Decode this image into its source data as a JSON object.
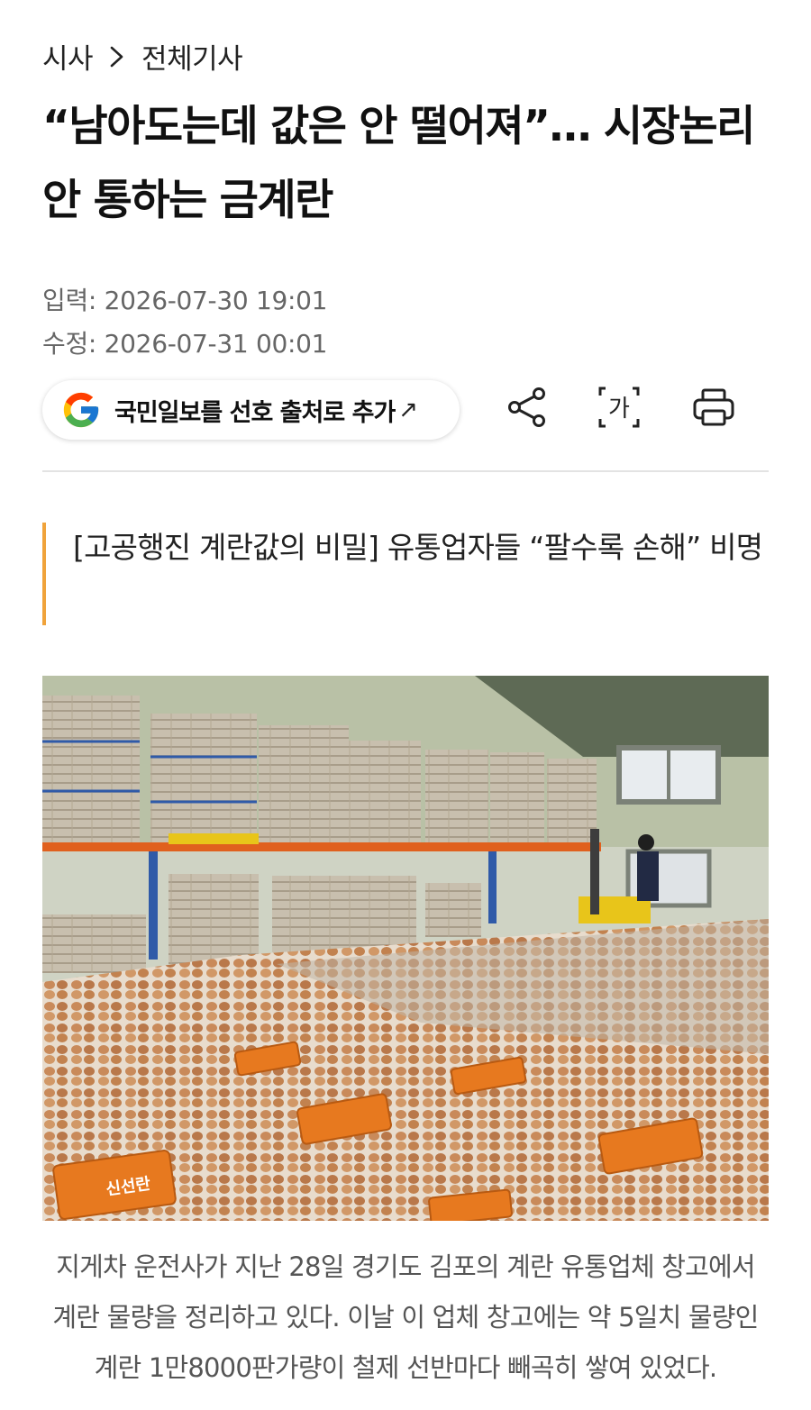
{
  "breadcrumb": {
    "section": "시사",
    "subsection": "전체기사"
  },
  "headline": "“남아도는데 값은 안 떨어져”… 시장논리 안 통하는 금계란",
  "meta": {
    "published": "입력: 2026-07-30 19:01",
    "updated": "수정: 2026-07-31 00:01"
  },
  "google_source": {
    "label": "국민일보를 선호 출처로 추가",
    "arrow": "↗"
  },
  "toolbar": {
    "share_icon": "share-icon",
    "font_icon": "font-size-icon",
    "font_glyph": "가",
    "print_icon": "print-icon"
  },
  "subheadline": "[고공행진 계란값의 비밀] 유통업자들 “팔수록 손해” 비명",
  "photo": {
    "description_icon": "photo",
    "egg_label": "신선란"
  },
  "caption": "지게차 운전사가 지난 28일 경기도 김포의 계란 유통업체 창고에서 계란 물량을 정리하고 있다. 이날 이 업체 창고에는 약 5일치 물량인 계란 1만8000판가량이 철제 선반마다 빼곡히 쌓여 있었다.",
  "colors": {
    "accent_bar": "#f0a33b",
    "divider": "#e3e3e3",
    "meta_text": "#666666"
  }
}
